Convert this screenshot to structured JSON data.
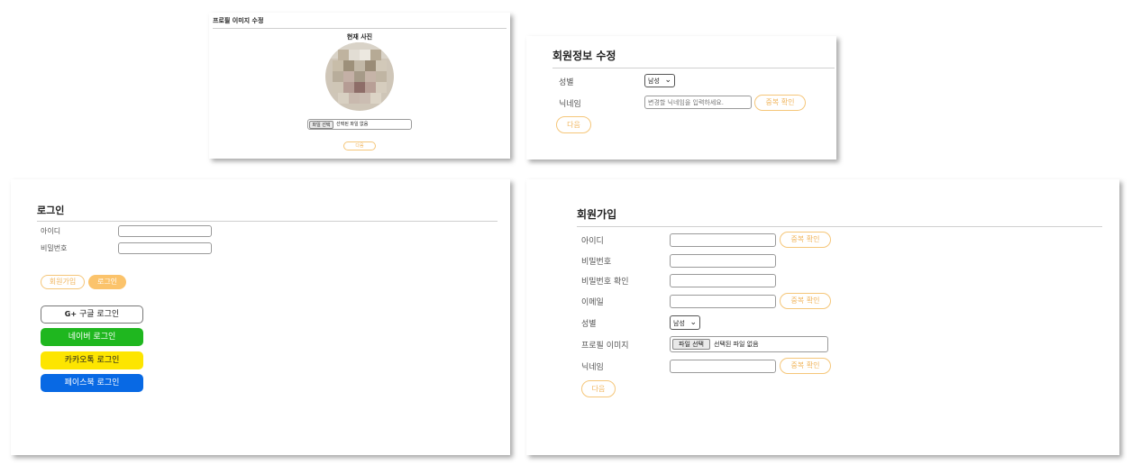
{
  "profile_edit": {
    "title": "프로필 이미지 수정",
    "current_photo_label": "현재 사진",
    "file_button": "파일 선택",
    "file_status": "선택된 파일 없음",
    "next_button": "다음"
  },
  "member_edit": {
    "title": "회원정보 수정",
    "gender_label": "성별",
    "gender_value": "남성",
    "nickname_label": "닉네임",
    "nickname_placeholder": "변경할 닉네임을 입력하세요.",
    "dup_check_button": "중복 확인",
    "next_button": "다음"
  },
  "login": {
    "title": "로그인",
    "id_label": "아이디",
    "password_label": "비밀번호",
    "signup_button": "회원가입",
    "login_button": "로그인",
    "google_button": "구글 로그인",
    "google_icon": "G+",
    "naver_button": "네이버 로그인",
    "kakao_button": "카카오톡 로그인",
    "facebook_button": "페이스북 로그인",
    "colors": {
      "naver": "#1fb71f",
      "kakao": "#fde500",
      "facebook": "#0869e4",
      "accent": "#fbc36b"
    }
  },
  "signup": {
    "title": "회원가입",
    "id_label": "아이디",
    "password_label": "비밀번호",
    "password_confirm_label": "비밀번호 확인",
    "email_label": "이메일",
    "gender_label": "성별",
    "gender_value": "남성",
    "profile_image_label": "프로필 이미지",
    "file_button": "파일 선택",
    "file_status": "선택된 파일 없음",
    "nickname_label": "닉네임",
    "dup_check_button": "중복 확인",
    "next_button": "다음"
  }
}
